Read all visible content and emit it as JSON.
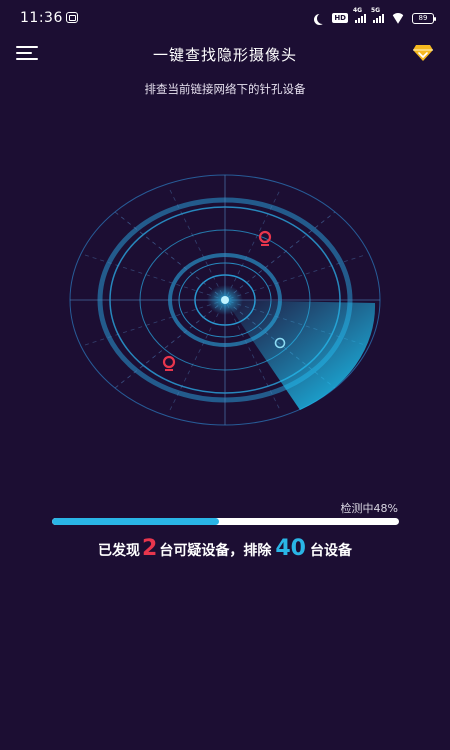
{
  "status_bar": {
    "time": "11:36",
    "hd_label": "HD",
    "signal1_label": "4G",
    "signal2_label": "5G",
    "battery": "89"
  },
  "header": {
    "title": "一键查找隐形摄像头",
    "subtitle": "排查当前链接网络下的针孔设备"
  },
  "progress": {
    "label": "检测中48%",
    "value": 0.48
  },
  "result": {
    "prefix": "已发现",
    "suspicious_count": "2",
    "middle": "台可疑设备，排除",
    "excluded_count": "40",
    "suffix": "台设备"
  },
  "colors": {
    "background": "#1c0e33",
    "accent_blue": "#2ab5e6",
    "alert_red": "#e8364d",
    "vip_gold": "#f5b820"
  }
}
